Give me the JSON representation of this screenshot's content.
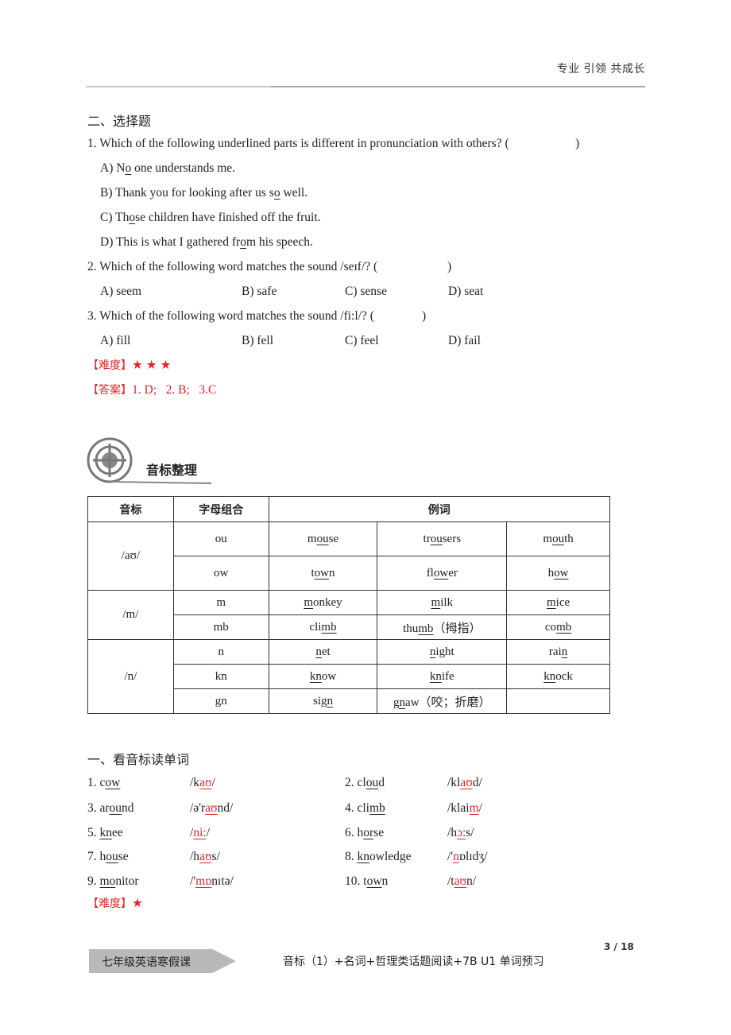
{
  "header": {
    "slogan": "专业 引领 共成长"
  },
  "choice_section": {
    "title": "二、选择题",
    "questions": [
      {
        "number": "1.",
        "text": "Which of the following underlined parts is different in pronunciation with others? (",
        "close": ")",
        "options": [
          {
            "prefix": "A) N",
            "underlined": "o",
            "suffix": " one understands me."
          },
          {
            "prefix": "B) Thank you for looking after us s",
            "underlined": "o",
            "suffix": " well."
          },
          {
            "prefix": "C) Th",
            "underlined": "o",
            "suffix": "se children have finished off the fruit."
          },
          {
            "prefix": "D) This is what I gathered fr",
            "underlined": "o",
            "suffix": "m his speech."
          }
        ]
      },
      {
        "number": "2.",
        "text": "Which of the following word matches the sound /seɪf/?   (",
        "close": ")",
        "options": [
          "A) seem",
          "B) safe",
          "C) sense",
          "D) seat"
        ]
      },
      {
        "number": "3.",
        "text": "Which of the following word matches the sound /fi:l/? (",
        "close": ")",
        "options": [
          "A) fill",
          "B) fell",
          "C) feel",
          "D) fail"
        ]
      }
    ],
    "difficulty_label": "【难度】",
    "difficulty_stars": "★ ★ ★",
    "answer_label": "【答案】",
    "answer_text": "1. D;   2. B;   3.C"
  },
  "phonetics_section": {
    "title": "音标整理",
    "icon": "target-icon",
    "table": {
      "headers": [
        "音标",
        "字母组合",
        "例词"
      ],
      "groups": [
        {
          "symbol": "/aʊ/",
          "rows": [
            {
              "combo": "ou",
              "words": [
                {
                  "pre": "m",
                  "u": "ou",
                  "post": "se"
                },
                {
                  "pre": "tr",
                  "u": "ou",
                  "post": "sers"
                },
                {
                  "pre": "m",
                  "u": "ou",
                  "post": "th"
                }
              ]
            },
            {
              "combo": "ow",
              "words": [
                {
                  "pre": "t",
                  "u": "ow",
                  "post": "n"
                },
                {
                  "pre": "fl",
                  "u": "ow",
                  "post": "er"
                },
                {
                  "pre": "h",
                  "u": "ow",
                  "post": ""
                }
              ]
            }
          ]
        },
        {
          "symbol": "/m/",
          "rows": [
            {
              "combo": "m",
              "words": [
                {
                  "pre": "",
                  "u": "m",
                  "post": "onkey"
                },
                {
                  "pre": "",
                  "u": "m",
                  "post": "ilk"
                },
                {
                  "pre": "",
                  "u": "m",
                  "post": "ice"
                }
              ]
            },
            {
              "combo": "mb",
              "words": [
                {
                  "pre": "cli",
                  "u": "mb",
                  "post": ""
                },
                {
                  "pre": "thu",
                  "u": "mb",
                  "post": "（拇指）"
                },
                {
                  "pre": "co",
                  "u": "mb",
                  "post": ""
                }
              ]
            }
          ]
        },
        {
          "symbol": "/n/",
          "rows": [
            {
              "combo": "n",
              "words": [
                {
                  "pre": "",
                  "u": "n",
                  "post": "et"
                },
                {
                  "pre": "",
                  "u": "n",
                  "post": "ight"
                },
                {
                  "pre": "rai",
                  "u": "n",
                  "post": ""
                }
              ]
            },
            {
              "combo": "kn",
              "words": [
                {
                  "pre": "",
                  "u": "kn",
                  "post": "ow"
                },
                {
                  "pre": "",
                  "u": "kn",
                  "post": "ife"
                },
                {
                  "pre": "",
                  "u": "kn",
                  "post": "ock"
                }
              ]
            },
            {
              "combo": "gn",
              "words": [
                {
                  "pre": "si",
                  "u": "gn",
                  "post": ""
                },
                {
                  "pre": "",
                  "u": "gn",
                  "post": "aw（咬；折磨）"
                },
                {
                  "pre": "",
                  "u": "",
                  "post": ""
                }
              ]
            }
          ]
        }
      ]
    }
  },
  "reading_section": {
    "title": "一、看音标读单词",
    "items": [
      {
        "num": "1. ",
        "w_pre": "c",
        "w_u": "ow",
        "w_post": "",
        "p_pre": "/k",
        "p_u": "aʊ",
        "p_post": "/"
      },
      {
        "num": "2. ",
        "w_pre": "cl",
        "w_u": "ou",
        "w_post": "d",
        "p_pre": "/kl",
        "p_u": "aʊ",
        "p_post": "d/"
      },
      {
        "num": "3. ",
        "w_pre": "ar",
        "w_u": "ou",
        "w_post": "nd",
        "p_pre": "/ə'r",
        "p_u": "aʊ",
        "p_post": "nd/"
      },
      {
        "num": "4. ",
        "w_pre": "cli",
        "w_u": "mb",
        "w_post": "",
        "p_pre": "/klai",
        "p_u": "m",
        "p_post": "/"
      },
      {
        "num": "5. ",
        "w_pre": "",
        "w_u": "kn",
        "w_post": "ee",
        "p_pre": "/",
        "p_u": "ni:",
        "p_post": "/"
      },
      {
        "num": "6. ",
        "w_pre": "h",
        "w_u": "or",
        "w_post": "se",
        "p_pre": "/h",
        "p_u": "ɔ:",
        "p_post": "s/"
      },
      {
        "num": "7. ",
        "w_pre": "h",
        "w_u": "ou",
        "w_post": "se",
        "p_pre": "/h",
        "p_u": "aʊ",
        "p_post": "s/"
      },
      {
        "num": "8. ",
        "w_pre": "",
        "w_u": "kn",
        "w_post": "owledge",
        "p_pre": "/'",
        "p_u": "n",
        "p_post": "ɒlɪdʒ/"
      },
      {
        "num": "9. ",
        "w_pre": "",
        "w_u": "mo",
        "w_post": "nitor",
        "p_pre": "/'",
        "p_u": "mɒ",
        "p_post": "nɪtə/"
      },
      {
        "num": "10. ",
        "w_pre": "t",
        "w_u": "ow",
        "w_post": "n",
        "p_pre": "/t",
        "p_u": "aʊ",
        "p_post": "n/"
      }
    ],
    "difficulty_label": "【难度】",
    "difficulty_stars": "★"
  },
  "footer": {
    "course_tag": "七年级英语寒假课",
    "lesson_title": "音标（1）+名词+哲理类话题阅读+7B U1 单词预习",
    "page": "3 / 18"
  },
  "colors": {
    "accent_red": "#e0262a",
    "tag_gray": "#b9b9b9"
  }
}
